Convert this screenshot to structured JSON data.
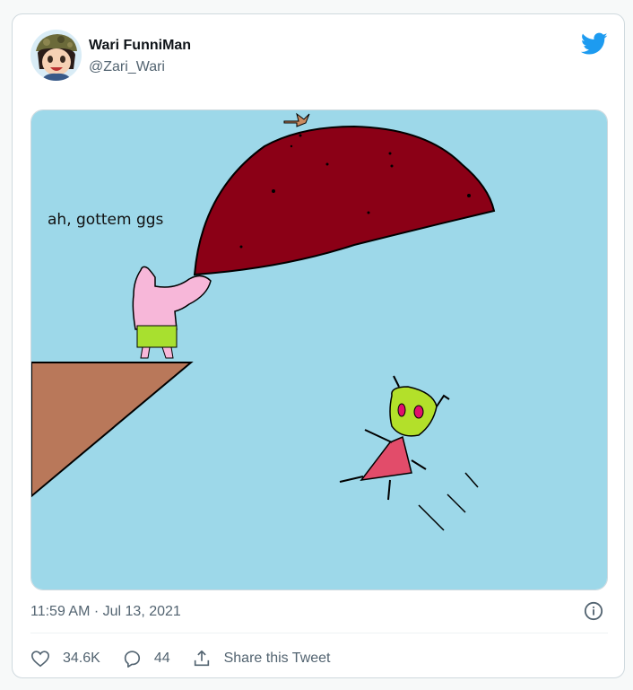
{
  "tweet": {
    "display_name": "Wari FunniMan",
    "handle": "@Zari_Wari",
    "timestamp": "11:59 AM · Jul 13, 2021",
    "image_caption": "ah, gottem ggs",
    "likes": "34.6K",
    "replies": "44",
    "share_label": "Share this Tweet"
  },
  "colors": {
    "brand": "#1d9bf0",
    "text_primary": "#0f1419",
    "text_secondary": "#536471",
    "sky": "#9dd8e9",
    "cliff": "#b9785a",
    "blob": "#8b0016"
  },
  "icons": {
    "logo": "twitter-bird-icon",
    "info": "info-icon",
    "like": "heart-icon",
    "reply": "reply-icon",
    "share": "share-icon"
  }
}
